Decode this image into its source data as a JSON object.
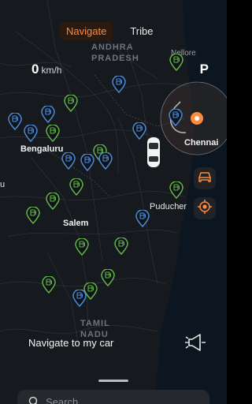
{
  "tabs": [
    {
      "label": "Navigate",
      "active": true
    },
    {
      "label": "Tribe",
      "active": false
    }
  ],
  "speed": {
    "value": "0",
    "unit": "km/h"
  },
  "gear": "P",
  "map": {
    "regions": [
      "ANDHRA",
      "PRADESH",
      "TAMIL",
      "NADU"
    ],
    "cities": [
      "Nellore",
      "Chennai",
      "Bengaluru",
      "Salem",
      "Puducher"
    ],
    "edge_label": "u"
  },
  "actions": {
    "navigate_to_car": "Navigate to my car"
  },
  "search": {
    "placeholder": "Search"
  },
  "colors": {
    "accent": "#ff8a3d",
    "charger_blue": "#4e8bd6",
    "charger_green": "#63b646",
    "water": "#0b1620",
    "land": "#161a1f"
  },
  "icons": {
    "vehicle": "car-top-view",
    "charger": "ev-charger-pin",
    "car_button": "car-icon",
    "locate_button": "locate-target-icon",
    "horn": "horn-icon",
    "search": "search-icon"
  }
}
